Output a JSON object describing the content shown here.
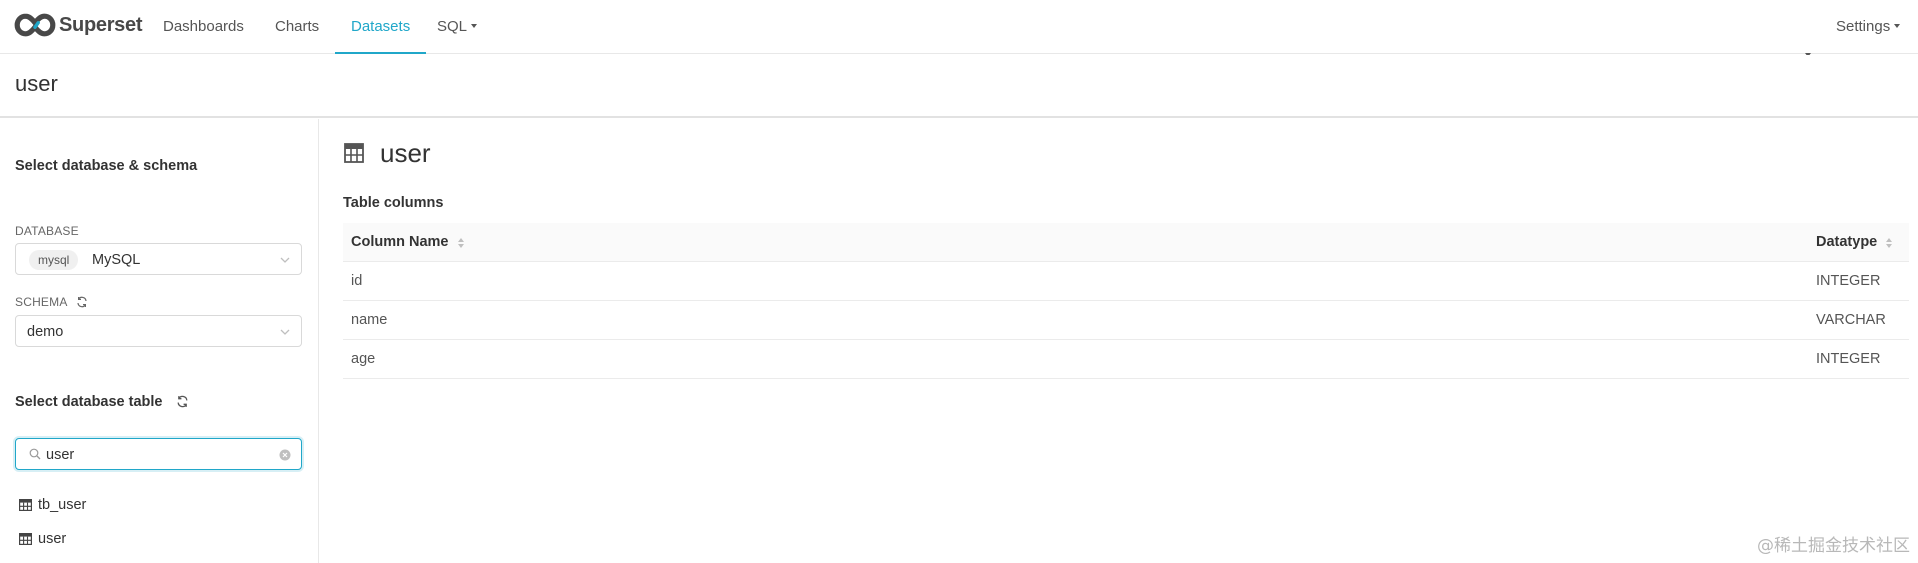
{
  "brand": {
    "name": "Superset"
  },
  "nav": {
    "items": [
      {
        "label": "Dashboards"
      },
      {
        "label": "Charts"
      },
      {
        "label": "Datasets"
      },
      {
        "label": "SQL"
      }
    ],
    "settings_label": "Settings",
    "active_color": "#20a7c9"
  },
  "header": {
    "title": "user"
  },
  "left": {
    "db_section_title": "Select database & schema",
    "database_label": "DATABASE",
    "database": {
      "tag": "mysql",
      "name": "MySQL"
    },
    "schema_label": "SCHEMA",
    "schema_value": "demo",
    "table_section_title": "Select database table",
    "search_value": "user",
    "tables": [
      {
        "name": "tb_user"
      },
      {
        "name": "user"
      }
    ]
  },
  "main": {
    "title": "user",
    "table_columns_label": "Table columns",
    "headers": {
      "column_name": "Column Name",
      "datatype": "Datatype"
    },
    "rows": [
      {
        "name": "id",
        "type": "INTEGER"
      },
      {
        "name": "name",
        "type": "VARCHAR"
      },
      {
        "name": "age",
        "type": "INTEGER"
      }
    ]
  },
  "watermark": "@稀土掘金技术社区"
}
